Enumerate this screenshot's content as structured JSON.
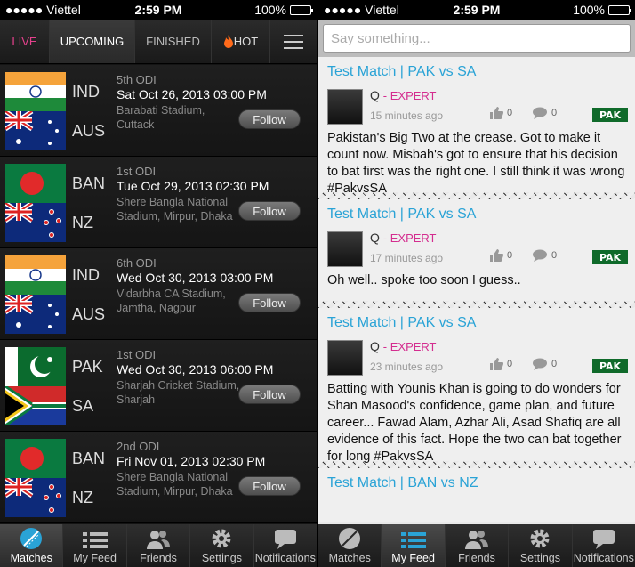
{
  "status": {
    "carrier": "●●●●● Viettel",
    "time": "2:59 PM",
    "battery": "100%",
    "battery_level": 1.0
  },
  "tabs": {
    "live": "LIVE",
    "upcoming": "UPCOMING",
    "finished": "FINISHED",
    "hot": "HOT"
  },
  "matches": [
    {
      "team1": "IND",
      "team2": "AUS",
      "odi": "5th ODI",
      "date": "Sat Oct 26, 2013 03:00 PM",
      "venue": "Barabati Stadium, Cuttack",
      "follow": "Follow"
    },
    {
      "team1": "BAN",
      "team2": "NZ",
      "odi": "1st ODI",
      "date": "Tue Oct 29, 2013 02:30 PM",
      "venue": "Shere Bangla National Stadium, Mirpur, Dhaka",
      "follow": "Follow"
    },
    {
      "team1": "IND",
      "team2": "AUS",
      "odi": "6th ODI",
      "date": "Wed Oct 30, 2013 03:00 PM",
      "venue": "Vidarbha CA Stadium, Jamtha, Nagpur",
      "follow": "Follow"
    },
    {
      "team1": "PAK",
      "team2": "SA",
      "odi": "1st ODI",
      "date": "Wed Oct 30, 2013 06:00 PM",
      "venue": "Sharjah Cricket Stadium, Sharjah",
      "follow": "Follow"
    },
    {
      "team1": "BAN",
      "team2": "NZ",
      "odi": "2nd ODI",
      "date": "Fri Nov 01, 2013 02:30 PM",
      "venue": "Shere Bangla National Stadium, Mirpur, Dhaka",
      "follow": "Follow"
    }
  ],
  "bottom_left": [
    "Matches",
    "My Feed",
    "Friends",
    "Settings",
    "Notifications"
  ],
  "bottom_right": [
    "Matches",
    "My Feed",
    "Friends",
    "Settings",
    "Notifications"
  ],
  "search": {
    "placeholder": "Say something..."
  },
  "posts": [
    {
      "title": "Test Match | PAK vs SA",
      "author": "Q",
      "role": "- EXPERT",
      "ago": "15 minutes ago",
      "likes": "0",
      "comments": "0",
      "tag": "PAK",
      "body": "Pakistan's Big Two at the crease. Got to make it count now. Misbah's got to ensure that his decision to bat first was the right one. I still think it was wrong #PakvsSA"
    },
    {
      "title": "Test Match | PAK vs SA",
      "author": "Q",
      "role": "- EXPERT",
      "ago": "17 minutes ago",
      "likes": "0",
      "comments": "0",
      "tag": "PAK",
      "body": "Oh well.. spoke too soon I guess.."
    },
    {
      "title": "Test Match | PAK vs SA",
      "author": "Q",
      "role": "- EXPERT",
      "ago": "23 minutes ago",
      "likes": "0",
      "comments": "0",
      "tag": "PAK",
      "body": "Batting with Younis Khan is going to do wonders for Shan Masood's confidence, game plan, and future career... Fawad Alam, Azhar Ali, Asad Shafiq are all evidence of this fact. Hope the two can bat together for long #PakvsSA"
    },
    {
      "title": "Test Match | BAN vs NZ"
    }
  ]
}
